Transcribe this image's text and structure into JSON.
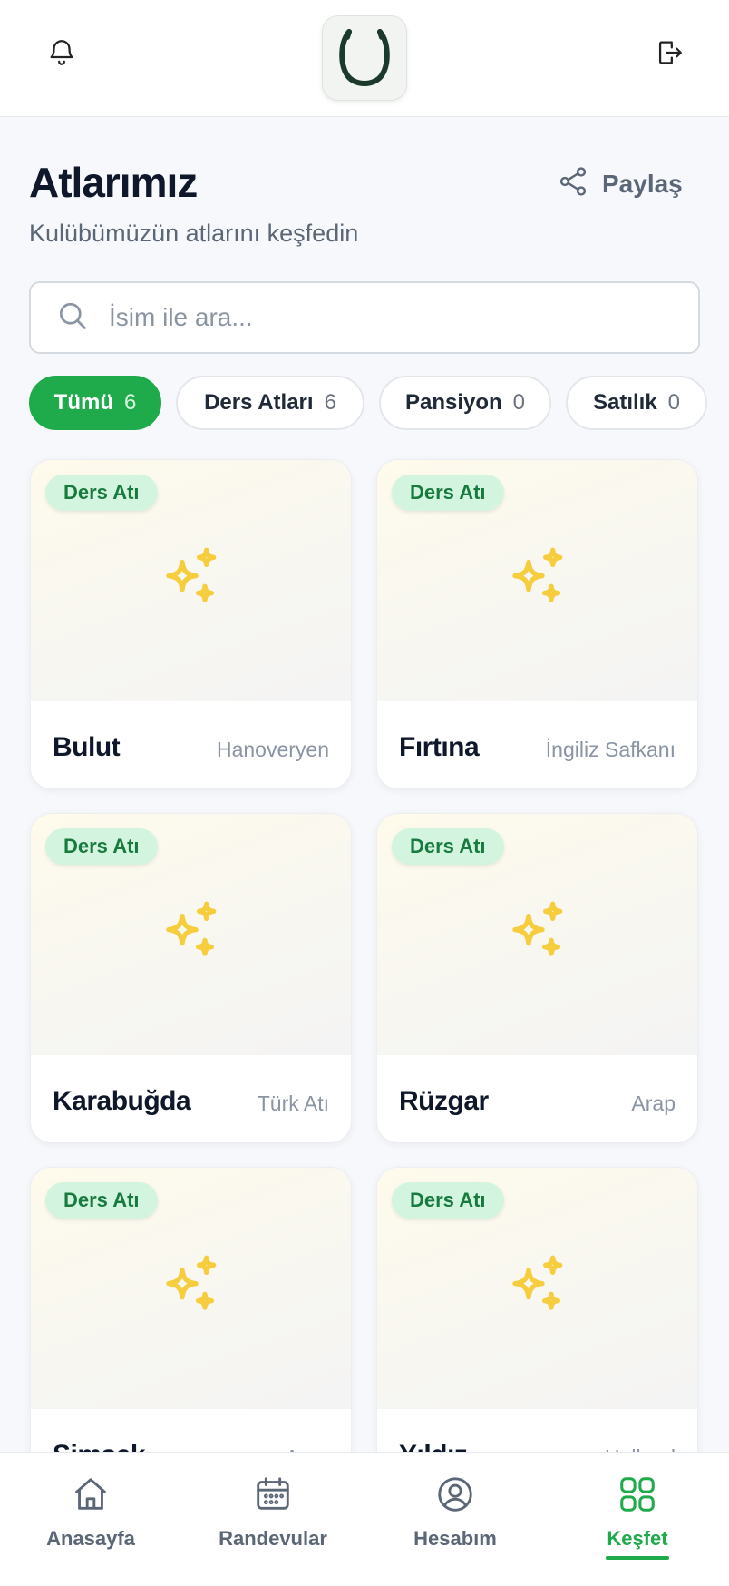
{
  "header": {
    "bell_icon": "bell-icon",
    "logo_icon": "horseshoe-logo-icon",
    "logout_icon": "logout-icon"
  },
  "page": {
    "title": "Atlarımız",
    "subtitle": "Kulübümüzün atlarını keşfedin",
    "share_label": "Paylaş"
  },
  "search": {
    "placeholder": "İsim ile ara...",
    "value": ""
  },
  "filters": [
    {
      "label": "Tümü",
      "count": "6",
      "active": true
    },
    {
      "label": "Ders Atları",
      "count": "6",
      "active": false
    },
    {
      "label": "Pansiyon",
      "count": "0",
      "active": false
    },
    {
      "label": "Satılık",
      "count": "0",
      "active": false
    }
  ],
  "horses": [
    {
      "badge": "Ders Atı",
      "name": "Bulut",
      "breed": "Hanoveryen"
    },
    {
      "badge": "Ders Atı",
      "name": "Fırtına",
      "breed": "İngiliz Safkanı"
    },
    {
      "badge": "Ders Atı",
      "name": "Karabuğda",
      "breed": "Türk Atı"
    },
    {
      "badge": "Ders Atı",
      "name": "Rüzgar",
      "breed": "Arap"
    },
    {
      "badge": "Ders Atı",
      "name": "Şimşek",
      "breed": "Arap"
    },
    {
      "badge": "Ders Atı",
      "name": "Yıldız",
      "breed": "Holland"
    }
  ],
  "bottom_nav": [
    {
      "label": "Anasayfa",
      "icon": "home-icon",
      "active": false
    },
    {
      "label": "Randevular",
      "icon": "calendar-icon",
      "active": false
    },
    {
      "label": "Hesabım",
      "icon": "user-circle-icon",
      "active": false
    },
    {
      "label": "Keşfet",
      "icon": "grid-icon",
      "active": true
    }
  ],
  "colors": {
    "accent": "#1faa4b",
    "badge_bg": "#d3f5df",
    "badge_text": "#187a3f",
    "sparkle": "#f5cd3d"
  }
}
